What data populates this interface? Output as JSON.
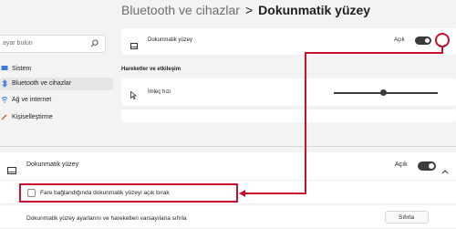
{
  "search": {
    "placeholder": "ayar bulun"
  },
  "sidebar": {
    "items": [
      {
        "label": "Sistem"
      },
      {
        "label": "Bluetooth ve cihazlar",
        "selected": true
      },
      {
        "label": "Ağ ve internet"
      },
      {
        "label": "Kişiselleştirme"
      }
    ]
  },
  "header": {
    "parent": "Bluetooth ve cihazlar",
    "separator": ">",
    "current": "Dokunmatik yüzey"
  },
  "touchpad_top": {
    "label": "Dokunmatik yüzey",
    "state": "Açık"
  },
  "section": {
    "title": "Hareketler ve etkileşim"
  },
  "cursor_speed": {
    "label": "İmleç hızı",
    "value_fraction": 0.55
  },
  "touchpad_zoom": {
    "label": "Dokunmatik yüzey",
    "state": "Açık",
    "checkbox_label": "Fare bağlandığında dokunmatik yüzeyi açık bırak",
    "reset_label": "Dokunmatik yüzey ayarlarını ve hareketleri varsayılana sıfırla",
    "reset_button": "Sıfırla"
  },
  "colors": {
    "annotation": "#c8102e",
    "toggle_on": "#3b3b3b"
  }
}
